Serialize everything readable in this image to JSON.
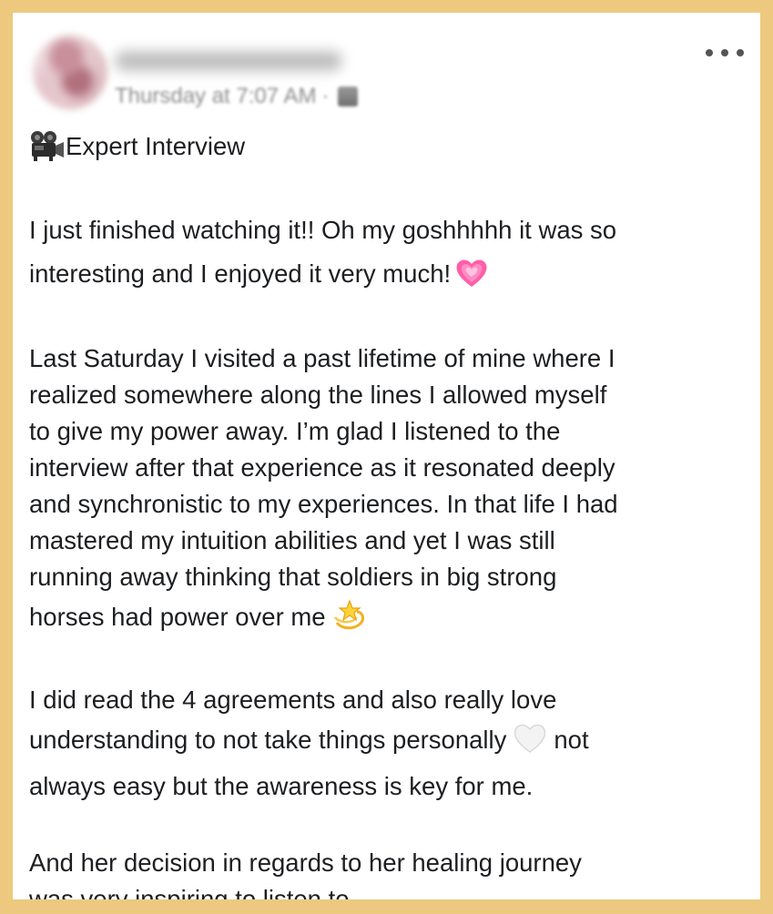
{
  "post": {
    "timestamp": "Thursday at 7:07 AM",
    "separator": "·",
    "title_icon": "movie-camera-icon",
    "title": "Expert Interview",
    "paragraphs": [
      {
        "text": "I just finished watching it!! Oh my goshhhhh it was so\ninteresting and I enjoyed it very much!",
        "emoji": "growing-heart-icon"
      },
      {
        "text": "Last Saturday I visited a past lifetime of mine where I\nrealized somewhere along the lines I allowed myself\nto give my power away. I’m glad I listened to the\ninterview after that experience as it resonated deeply\nand synchronistic to my experiences. In that life I had\nmastered my intuition abilities and yet I was still\nrunning away thinking that soldiers in big strong\nhorses had power over me",
        "emoji": "dizzy-star-icon"
      },
      {
        "text_a": "I did read the 4 agreements and also really love\nunderstanding to not take things personally",
        "emoji": "white-heart-icon",
        "text_b": "not\nalways easy but the awareness is key for me."
      },
      {
        "text": "And her decision in regards to her healing journey\nwas very inspiring to listen to."
      }
    ]
  },
  "colors": {
    "frame": "#ecc97f",
    "card": "#ffffff",
    "text": "#1c1e21",
    "meta_text": "#8d8d8d"
  }
}
